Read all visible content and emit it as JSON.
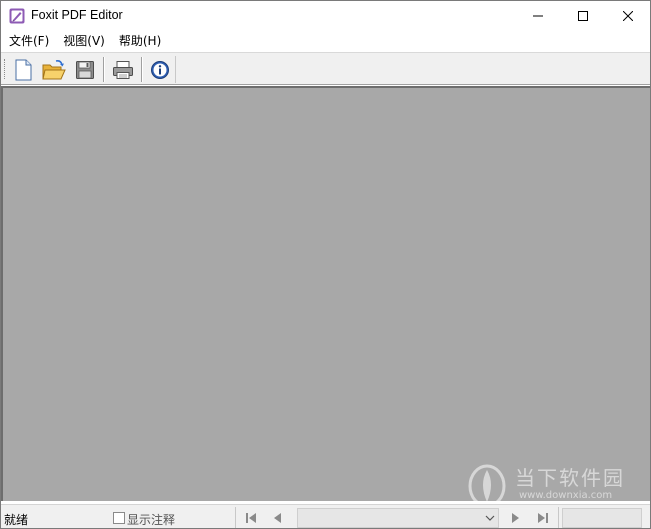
{
  "window": {
    "title": "Foxit PDF Editor",
    "icon": "foxit-app-icon",
    "controls": {
      "minimize": "minimize-icon",
      "maximize": "maximize-icon",
      "close": "close-icon"
    }
  },
  "menubar": {
    "items": [
      {
        "label": "文件(F)"
      },
      {
        "label": "视图(V)"
      },
      {
        "label": "帮助(H)"
      }
    ]
  },
  "toolbar": {
    "buttons": [
      {
        "icon": "new-document-icon"
      },
      {
        "icon": "open-folder-icon"
      },
      {
        "icon": "save-icon"
      },
      {
        "icon": "print-icon"
      },
      {
        "icon": "info-icon"
      }
    ]
  },
  "colors": {
    "document_background": "#a8a8a8",
    "chrome": "#f0f0f0"
  },
  "statusbar": {
    "status": "就绪",
    "show_annotations_label": "显示注释",
    "show_annotations_checked": false,
    "page_value": "",
    "zoom_value": "",
    "nav_icons": [
      "first-page-icon",
      "previous-page-icon",
      "next-page-icon",
      "last-page-icon"
    ]
  },
  "watermark": {
    "text": "当下软件园",
    "url": "www.downxia.com"
  }
}
